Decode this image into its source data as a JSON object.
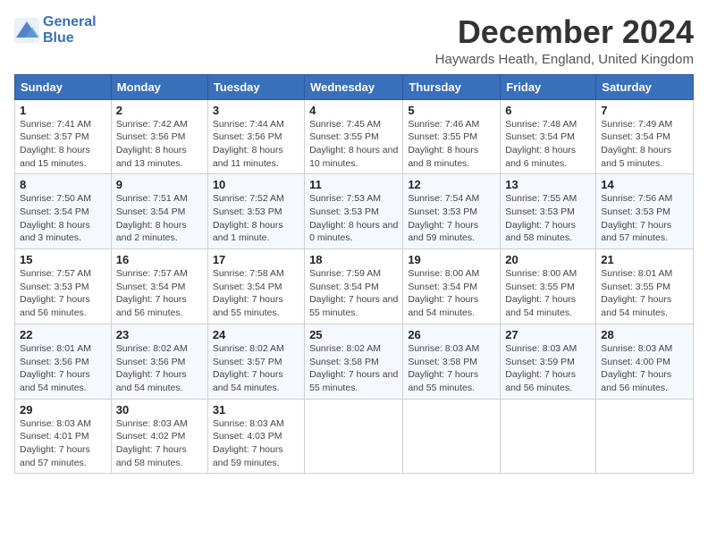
{
  "header": {
    "logo_line1": "General",
    "logo_line2": "Blue",
    "month_title": "December 2024",
    "location": "Haywards Heath, England, United Kingdom"
  },
  "weekdays": [
    "Sunday",
    "Monday",
    "Tuesday",
    "Wednesday",
    "Thursday",
    "Friday",
    "Saturday"
  ],
  "weeks": [
    [
      {
        "day": "1",
        "sunrise": "7:41 AM",
        "sunset": "3:57 PM",
        "daylight": "8 hours and 15 minutes."
      },
      {
        "day": "2",
        "sunrise": "7:42 AM",
        "sunset": "3:56 PM",
        "daylight": "8 hours and 13 minutes."
      },
      {
        "day": "3",
        "sunrise": "7:44 AM",
        "sunset": "3:56 PM",
        "daylight": "8 hours and 11 minutes."
      },
      {
        "day": "4",
        "sunrise": "7:45 AM",
        "sunset": "3:55 PM",
        "daylight": "8 hours and 10 minutes."
      },
      {
        "day": "5",
        "sunrise": "7:46 AM",
        "sunset": "3:55 PM",
        "daylight": "8 hours and 8 minutes."
      },
      {
        "day": "6",
        "sunrise": "7:48 AM",
        "sunset": "3:54 PM",
        "daylight": "8 hours and 6 minutes."
      },
      {
        "day": "7",
        "sunrise": "7:49 AM",
        "sunset": "3:54 PM",
        "daylight": "8 hours and 5 minutes."
      }
    ],
    [
      {
        "day": "8",
        "sunrise": "7:50 AM",
        "sunset": "3:54 PM",
        "daylight": "8 hours and 3 minutes."
      },
      {
        "day": "9",
        "sunrise": "7:51 AM",
        "sunset": "3:54 PM",
        "daylight": "8 hours and 2 minutes."
      },
      {
        "day": "10",
        "sunrise": "7:52 AM",
        "sunset": "3:53 PM",
        "daylight": "8 hours and 1 minute."
      },
      {
        "day": "11",
        "sunrise": "7:53 AM",
        "sunset": "3:53 PM",
        "daylight": "8 hours and 0 minutes."
      },
      {
        "day": "12",
        "sunrise": "7:54 AM",
        "sunset": "3:53 PM",
        "daylight": "7 hours and 59 minutes."
      },
      {
        "day": "13",
        "sunrise": "7:55 AM",
        "sunset": "3:53 PM",
        "daylight": "7 hours and 58 minutes."
      },
      {
        "day": "14",
        "sunrise": "7:56 AM",
        "sunset": "3:53 PM",
        "daylight": "7 hours and 57 minutes."
      }
    ],
    [
      {
        "day": "15",
        "sunrise": "7:57 AM",
        "sunset": "3:53 PM",
        "daylight": "7 hours and 56 minutes."
      },
      {
        "day": "16",
        "sunrise": "7:57 AM",
        "sunset": "3:54 PM",
        "daylight": "7 hours and 56 minutes."
      },
      {
        "day": "17",
        "sunrise": "7:58 AM",
        "sunset": "3:54 PM",
        "daylight": "7 hours and 55 minutes."
      },
      {
        "day": "18",
        "sunrise": "7:59 AM",
        "sunset": "3:54 PM",
        "daylight": "7 hours and 55 minutes."
      },
      {
        "day": "19",
        "sunrise": "8:00 AM",
        "sunset": "3:54 PM",
        "daylight": "7 hours and 54 minutes."
      },
      {
        "day": "20",
        "sunrise": "8:00 AM",
        "sunset": "3:55 PM",
        "daylight": "7 hours and 54 minutes."
      },
      {
        "day": "21",
        "sunrise": "8:01 AM",
        "sunset": "3:55 PM",
        "daylight": "7 hours and 54 minutes."
      }
    ],
    [
      {
        "day": "22",
        "sunrise": "8:01 AM",
        "sunset": "3:56 PM",
        "daylight": "7 hours and 54 minutes."
      },
      {
        "day": "23",
        "sunrise": "8:02 AM",
        "sunset": "3:56 PM",
        "daylight": "7 hours and 54 minutes."
      },
      {
        "day": "24",
        "sunrise": "8:02 AM",
        "sunset": "3:57 PM",
        "daylight": "7 hours and 54 minutes."
      },
      {
        "day": "25",
        "sunrise": "8:02 AM",
        "sunset": "3:58 PM",
        "daylight": "7 hours and 55 minutes."
      },
      {
        "day": "26",
        "sunrise": "8:03 AM",
        "sunset": "3:58 PM",
        "daylight": "7 hours and 55 minutes."
      },
      {
        "day": "27",
        "sunrise": "8:03 AM",
        "sunset": "3:59 PM",
        "daylight": "7 hours and 56 minutes."
      },
      {
        "day": "28",
        "sunrise": "8:03 AM",
        "sunset": "4:00 PM",
        "daylight": "7 hours and 56 minutes."
      }
    ],
    [
      {
        "day": "29",
        "sunrise": "8:03 AM",
        "sunset": "4:01 PM",
        "daylight": "7 hours and 57 minutes."
      },
      {
        "day": "30",
        "sunrise": "8:03 AM",
        "sunset": "4:02 PM",
        "daylight": "7 hours and 58 minutes."
      },
      {
        "day": "31",
        "sunrise": "8:03 AM",
        "sunset": "4:03 PM",
        "daylight": "7 hours and 59 minutes."
      },
      null,
      null,
      null,
      null
    ]
  ],
  "labels": {
    "sunrise_prefix": "Sunrise: ",
    "sunset_prefix": "Sunset: ",
    "daylight_prefix": "Daylight: "
  }
}
